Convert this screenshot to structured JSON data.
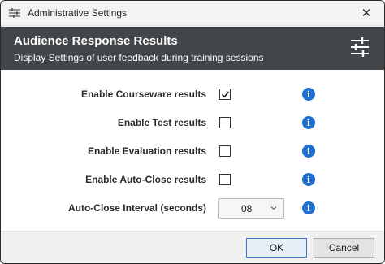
{
  "window": {
    "title": "Administrative Settings",
    "close_glyph": "✕",
    "icon": "settings-sliders-icon"
  },
  "header": {
    "title": "Audience Response Results",
    "subtitle": "Display Settings of user feedback during training sessions",
    "icon": "sliders-icon",
    "background": "#424649"
  },
  "settings": [
    {
      "label": "Enable Courseware results",
      "type": "checkbox",
      "checked": true
    },
    {
      "label": "Enable Test results",
      "type": "checkbox",
      "checked": false
    },
    {
      "label": "Enable Evaluation results",
      "type": "checkbox",
      "checked": false
    },
    {
      "label": "Enable Auto-Close results",
      "type": "checkbox",
      "checked": false
    },
    {
      "label": "Auto-Close Interval (seconds)",
      "type": "select",
      "value": "08"
    }
  ],
  "info_glyph": "i",
  "accent_color": "#1e6fd0",
  "footer": {
    "ok_label": "OK",
    "cancel_label": "Cancel"
  }
}
